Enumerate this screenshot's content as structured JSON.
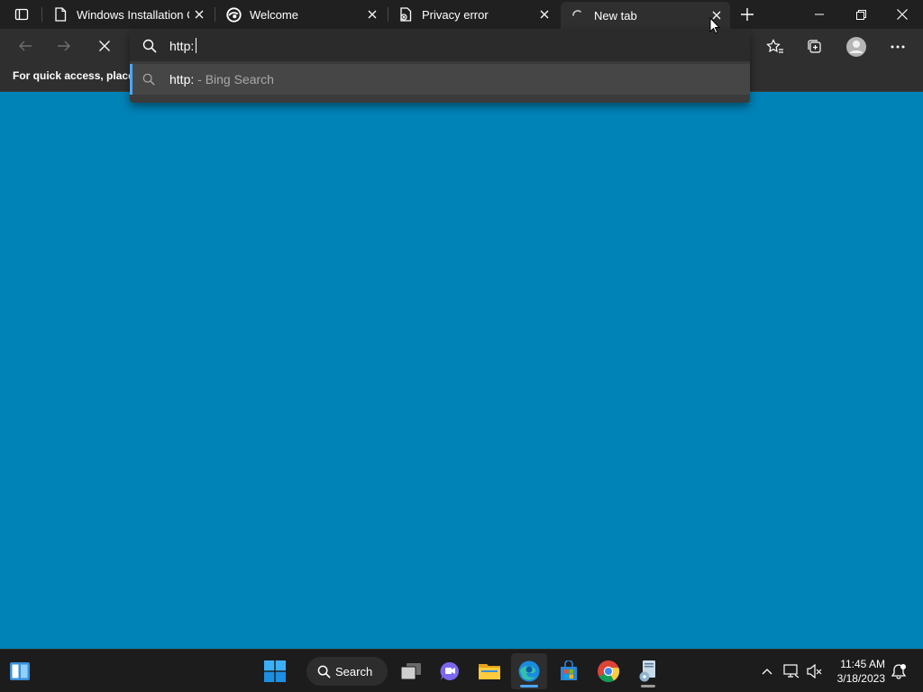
{
  "browser": {
    "tabs": [
      {
        "title": "Windows Installation C…",
        "icon": "document-icon",
        "active": false
      },
      {
        "title": "Welcome",
        "icon": "edge-icon",
        "active": false
      },
      {
        "title": "Privacy error",
        "icon": "error-document-icon",
        "active": false
      },
      {
        "title": "New tab",
        "icon": "loading-spinner-icon",
        "active": true
      }
    ],
    "favorites_bar_text": "For quick access, place y",
    "address_bar": {
      "value": "http:",
      "suggestion_main": "http:",
      "suggestion_sub": " - Bing Search"
    },
    "page_background": "#0083b7"
  },
  "taskbar": {
    "search_label": "Search",
    "apps": [
      "start-icon",
      "task-view-icon",
      "teams-chat-icon",
      "file-explorer-icon",
      "edge-icon",
      "store-icon",
      "chrome-icon",
      "installer-icon"
    ],
    "active_app": "edge-icon",
    "clock_time": "11:45 AM",
    "clock_date": "3/18/2023"
  },
  "colors": {
    "titlebar": "#202020",
    "toolbar": "#2f2f2f",
    "accent": "#4ca7f5",
    "taskbar": "#1c1c1c"
  }
}
